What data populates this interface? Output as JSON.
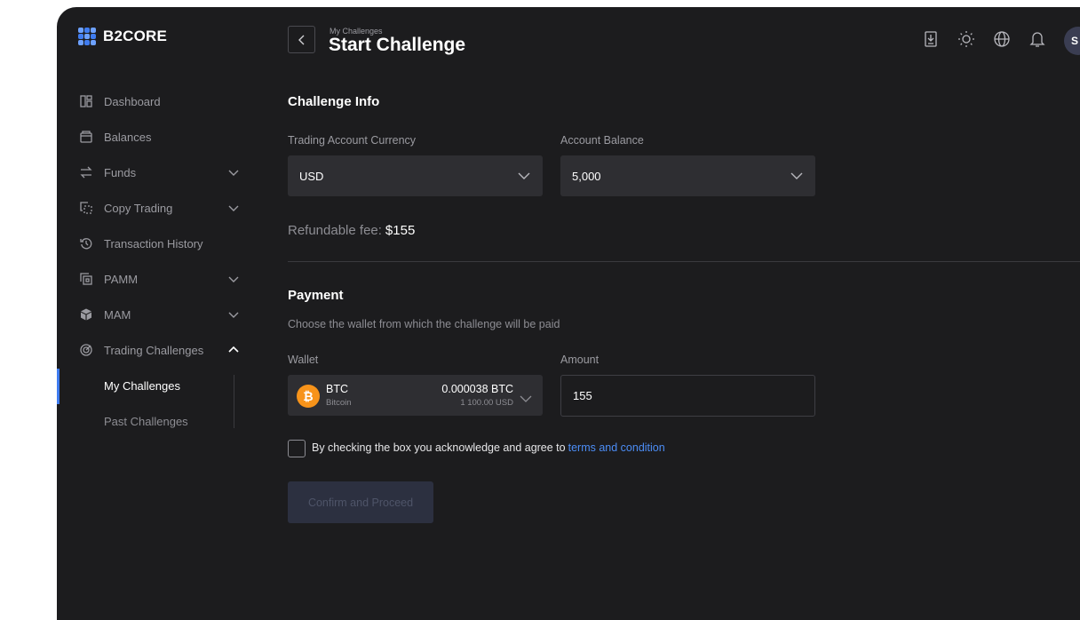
{
  "brand": {
    "name": "B2CORE"
  },
  "colors": {
    "accent": "#3f7cf0",
    "link": "#4c8df6",
    "bitcoin": "#f7931a",
    "background": "#1c1c1e",
    "field": "#2e2e32"
  },
  "sidebar": {
    "items": [
      {
        "label": "Dashboard",
        "icon": "dashboard-icon",
        "has_chevron": false
      },
      {
        "label": "Balances",
        "icon": "wallet-icon",
        "has_chevron": false
      },
      {
        "label": "Funds",
        "icon": "transfer-arrows-icon",
        "has_chevron": true
      },
      {
        "label": "Copy Trading",
        "icon": "copy-trading-icon",
        "has_chevron": true
      },
      {
        "label": "Transaction History",
        "icon": "history-icon",
        "has_chevron": false
      },
      {
        "label": "PAMM",
        "icon": "pamm-icon",
        "has_chevron": true
      },
      {
        "label": "MAM",
        "icon": "cube-icon",
        "has_chevron": true
      },
      {
        "label": "Trading Challenges",
        "icon": "target-icon",
        "has_chevron": true,
        "expanded": true
      }
    ],
    "subitems": [
      {
        "label": "My Challenges",
        "active": true
      },
      {
        "label": "Past Challenges",
        "active": false
      }
    ]
  },
  "header": {
    "breadcrumb": "My Challenges",
    "title": "Start Challenge",
    "icons": [
      "download-icon",
      "sun-icon",
      "globe-icon",
      "bell-icon"
    ],
    "avatar_initials": "S"
  },
  "challenge_info": {
    "title": "Challenge Info",
    "currency_label": "Trading Account Currency",
    "currency_value": "USD",
    "balance_label": "Account Balance",
    "balance_value": "5,000",
    "fee_label": "Refundable fee:",
    "fee_value": "$155"
  },
  "payment": {
    "title": "Payment",
    "description": "Choose the wallet from which the challenge will be paid",
    "wallet_label": "Wallet",
    "wallet": {
      "symbol": "BTC",
      "name": "Bitcoin",
      "balance": "0.000038 BTC",
      "balance_usd": "1 100.00 USD",
      "icon": "bitcoin-icon"
    },
    "amount_label": "Amount",
    "amount_value": "155",
    "agree_text": "By checking the box you acknowledge and agree to",
    "agree_link": "terms and condition",
    "agree_checked": false,
    "confirm_label": "Confirm and Proceed"
  }
}
